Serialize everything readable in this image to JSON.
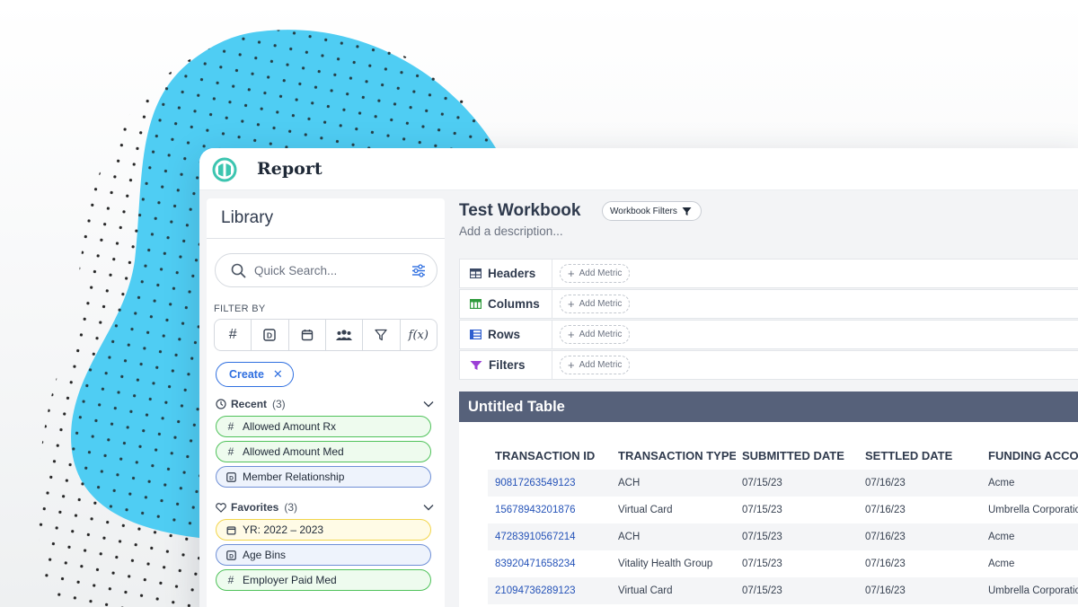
{
  "app": {
    "title": "Report"
  },
  "library": {
    "title": "Library",
    "search_placeholder": "Quick Search...",
    "filter_by_label": "FILTER BY",
    "filter_icons": [
      "hash-icon",
      "dimension-icon",
      "calendar-icon",
      "people-icon",
      "funnel-icon",
      "function-icon"
    ],
    "filter_glyphs": [
      "#",
      "D",
      "▦",
      "👥",
      "▽",
      "f(x)"
    ],
    "create_label": "Create",
    "recent": {
      "label": "Recent",
      "count": "(3)",
      "items": [
        {
          "label": "Allowed Amount Rx",
          "kind": "metric",
          "glyph": "#",
          "color": "green"
        },
        {
          "label": "Allowed Amount Med",
          "kind": "metric",
          "glyph": "#",
          "color": "green"
        },
        {
          "label": "Member Relationship",
          "kind": "dimension",
          "glyph": "D",
          "color": "blue"
        }
      ]
    },
    "favorites": {
      "label": "Favorites",
      "count": "(3)",
      "items": [
        {
          "label": "YR: 2022 – 2023",
          "kind": "date",
          "glyph": "▦",
          "color": "yellow"
        },
        {
          "label": "Age Bins",
          "kind": "dimension",
          "glyph": "D",
          "color": "blue"
        },
        {
          "label": "Employer Paid Med",
          "kind": "metric",
          "glyph": "#",
          "color": "green"
        }
      ]
    }
  },
  "workbook": {
    "title": "Test Workbook",
    "filters_label": "Workbook Filters",
    "description_placeholder": "Add a description...",
    "add_metric_label": "Add Metric",
    "shelves": [
      {
        "label": "Headers",
        "icon": "table-icon",
        "color": "#3b4a66"
      },
      {
        "label": "Columns",
        "icon": "columns-icon",
        "color": "#2e9a3c"
      },
      {
        "label": "Rows",
        "icon": "rows-icon",
        "color": "#2f5fcf"
      },
      {
        "label": "Filters",
        "icon": "funnel-icon",
        "color": "#9b3fd6"
      }
    ]
  },
  "table": {
    "title": "Untitled Table",
    "columns": [
      "TRANSACTION ID",
      "TRANSACTION TYPE",
      "SUBMITTED DATE",
      "SETTLED DATE",
      "FUNDING ACCOUNT"
    ],
    "rows": [
      [
        "90817263549123",
        "ACH",
        "07/15/23",
        "07/16/23",
        "Acme"
      ],
      [
        "15678943201876",
        "Virtual Card",
        "07/15/23",
        "07/16/23",
        "Umbrella Corporation"
      ],
      [
        "47283910567214",
        "ACH",
        "07/15/23",
        "07/16/23",
        "Acme"
      ],
      [
        "83920471658234",
        "Vitality Health Group",
        "07/15/23",
        "07/16/23",
        "Acme"
      ],
      [
        "21094736289123",
        "Virtual Card",
        "07/15/23",
        "07/16/23",
        "Umbrella Corporation"
      ]
    ]
  },
  "colors": {
    "blob": "#4fcdf3",
    "accent": "#2f6fe0",
    "table_header": "#56617a",
    "logo": "#3cc5b0"
  }
}
